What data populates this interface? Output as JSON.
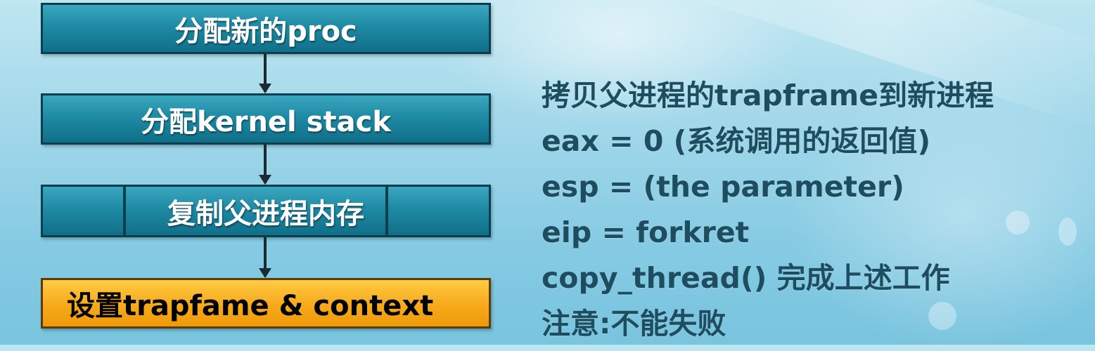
{
  "flowchart": {
    "steps": [
      "分配新的proc",
      "分配kernel stack",
      "复制父进程内存",
      "设置trapfame & context"
    ],
    "highlight_color": "#f7a91a",
    "box_color": "#1f8aa4"
  },
  "notes": {
    "lines": [
      "拷贝父进程的trapframe到新进程",
      "eax = 0  (系统调用的返回值)",
      "esp = (the parameter)",
      "eip = forkret",
      "copy_thread() 完成上述工作",
      "注意:不能失败"
    ],
    "text_color": "#1d4d5e"
  }
}
